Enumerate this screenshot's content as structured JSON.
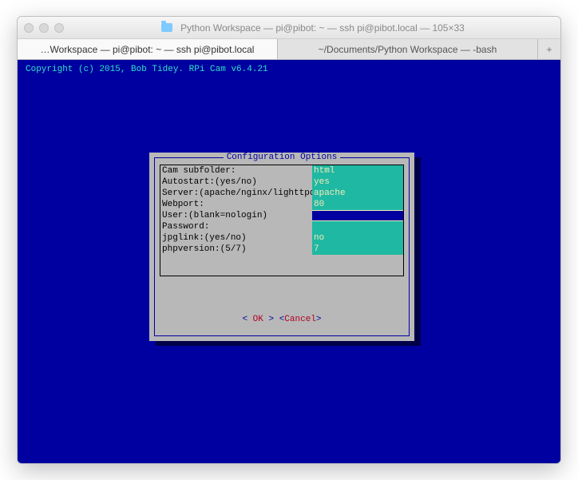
{
  "window": {
    "title": "Python Workspace — pi@pibot: ~ — ssh pi@pibot.local — 105×33"
  },
  "tabs": {
    "tab1": "…Workspace — pi@pibot: ~ — ssh pi@pibot.local",
    "tab2": "~/Documents/Python Workspace — -bash",
    "plus": "+"
  },
  "terminal": {
    "copyright": "Copyright (c) 2015, Bob Tidey. RPi Cam v6.4.21"
  },
  "dialog": {
    "title": "Configuration Options",
    "fields": [
      {
        "label": "Cam subfolder:",
        "value": "html"
      },
      {
        "label": "Autostart:(yes/no)",
        "value": "yes"
      },
      {
        "label": "Server:(apache/nginx/lighttpd)",
        "value": "apache"
      },
      {
        "label": "Webport:",
        "value": "80"
      },
      {
        "label": "User:(blank=nologin)",
        "value": "",
        "selected": true
      },
      {
        "label": "Password:",
        "value": ""
      },
      {
        "label": "jpglink:(yes/no)",
        "value": "no"
      },
      {
        "label": "phpversion:(5/7)",
        "value": "7"
      }
    ],
    "ok_left": "<  ",
    "ok": "OK",
    "ok_right": "  >",
    "gap": "        ",
    "cancel_left": "<",
    "cancel": "Cancel",
    "cancel_right": ">"
  }
}
